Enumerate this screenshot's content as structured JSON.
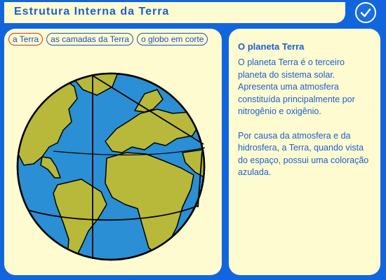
{
  "header": {
    "title": "Estrutura Interna da Terra"
  },
  "tabs": [
    {
      "label": "a Terra",
      "active": true
    },
    {
      "label": "as camadas da Terra",
      "active": false
    },
    {
      "label": "o globo em corte",
      "active": false
    }
  ],
  "info": {
    "heading": "O planeta Terra",
    "paragraphs": [
      "O planeta Terra é o terceiro planeta do sistema solar. Apresenta uma atmosfera constituída principalmente por nitrogênio e oxigênio.",
      "Por causa da atmosfera e da hidrosfera, a Terra, quando vista do espaço, possui uma coloração azulada."
    ]
  },
  "colors": {
    "background": "#1166dd",
    "panel": "#fffbd0",
    "ocean": "#2a8fd4",
    "land": "#b8b83a",
    "text": "#1a5fd0",
    "active_tab_border": "#d03030"
  },
  "icons": {
    "confirm": "checkmark-icon"
  }
}
